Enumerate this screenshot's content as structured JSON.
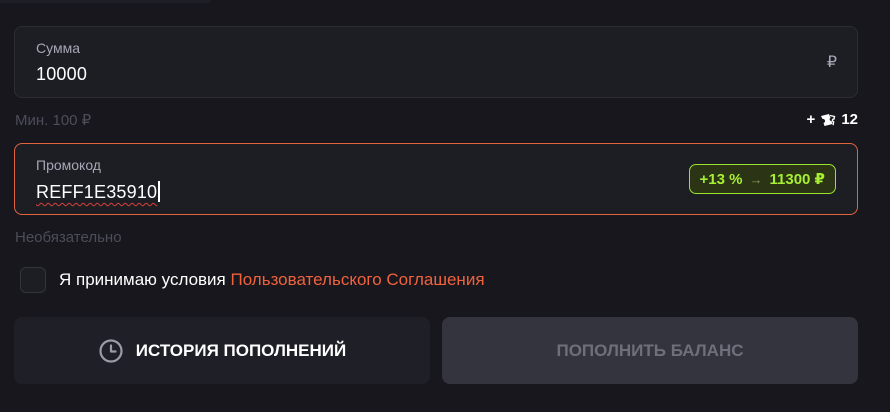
{
  "amount": {
    "label": "Сумма",
    "value": "10000",
    "currency": "₽",
    "min_hint": "Мин. 100 ₽"
  },
  "tickets": {
    "prefix": "+",
    "icon": "ticket-icon",
    "count": "12"
  },
  "promo": {
    "label": "Промокод",
    "value": "REFF1E35910",
    "bonus_percent": "+13 %",
    "bonus_arrow": "→",
    "bonus_total": "11300 ₽",
    "optional_hint": "Необязательно"
  },
  "agreement": {
    "checked": false,
    "text": "Я принимаю условия",
    "link": "Пользовательского Соглашения"
  },
  "buttons": {
    "history_icon": "clock-icon",
    "history": "ИСТОРИЯ ПОПОЛНЕНИЙ",
    "deposit": "ПОПОЛНИТЬ БАЛАНС"
  },
  "colors": {
    "background": "#17171d",
    "accent": "#f0623d",
    "bonus": "#a6ef33",
    "disabled_button": "#34343e"
  }
}
